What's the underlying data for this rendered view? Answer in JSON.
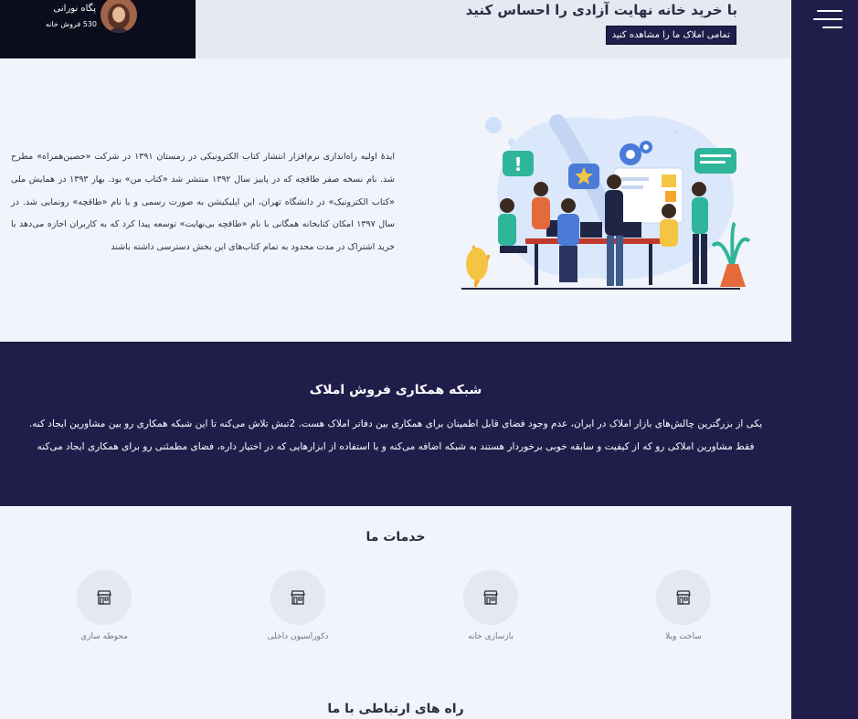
{
  "header": {
    "hero_title": "با خرید خانه نهایت آزادی را احساس کنید",
    "hero_button": "تمامی املاک ما را مشاهده کنید",
    "agent": {
      "name": "پگاه نورانی",
      "sales": "530 فروش خانه"
    }
  },
  "about": {
    "text": "ایدهٔ اولیه راه‌اندازی نرم‌افزار انتشار کتاب الکترونیکی در زمستان ۱۳۹۱ در شرکت «حصین‌همراه» مطرح شد. نام نسخه صفر طاقچه که در پاییز سال ۱۳۹۲ منتشر شد «کتاب من» بود. بهار ۱۳۹۳ در همایش ملی «کتاب الکترونیک» در دانشگاه تهران، این اپلیکیشن به صورت رسمی و با نام «طاقچه» رونمایی شد. در سال ۱۳۹۷ امکان کتابخانه همگانی با نام «طاقچه بی‌نهایت» توسعه پیدا کرد که به کاربران اجازه می‌دهد با خرید اشتراک در مدت محدود به تمام کتاب‌های این بخش دسترسی داشته باشند"
  },
  "network": {
    "title": "شبکه همکاری فروش املاک",
    "text": "یکی از بزرگترین چالش‌های بازار املاک در ایران، عدم وجود فضای قابل اطمینان برای همکاری بین دفاتر املاک هست. 2تبش تلاش می‌کنه تا این شبکه همکاری رو بین مشاورین ایجاد کنه. فقط مشاورین املاکی رو که از کیفیت و سابقه خوبی برخوردار هستند به شبکه اضافه می‌کنه و با استفاده از ابزارهایی که در اختیار داره، فضای مطمئنی رو برای همکاری ایجاد می‌کنه"
  },
  "services": {
    "title": "خدمات ما",
    "items": [
      {
        "label": "ساخت ویلا",
        "icon": "store-icon"
      },
      {
        "label": "بازسازی خانه",
        "icon": "store-icon"
      },
      {
        "label": "دکوراسیون داخلی",
        "icon": "store-icon"
      },
      {
        "label": "محوطه سازی",
        "icon": "store-icon"
      }
    ]
  },
  "contact": {
    "title": "راه های ارتباطی با ما"
  },
  "colors": {
    "navy": "#211d4b",
    "background": "#f1f4fa",
    "accent_blue": "#4a7bd8"
  }
}
